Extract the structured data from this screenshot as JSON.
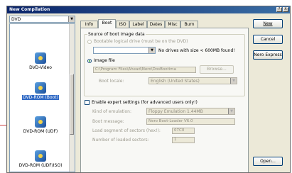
{
  "window": {
    "title": "New Compilation",
    "controls": {
      "help": "?",
      "close": "X"
    }
  },
  "media_combo": {
    "value": "DVD"
  },
  "disc_types": [
    {
      "label": "DVD-Video",
      "selected": false
    },
    {
      "label": "DVD-ROM (Boot)",
      "selected": true
    },
    {
      "label": "DVD-ROM (UDF)",
      "selected": false
    },
    {
      "label": "DVD-ROM (UDF/ISO)",
      "selected": false
    }
  ],
  "tabs": [
    "Info",
    "Boot",
    "ISO",
    "Label",
    "Dates",
    "Misc",
    "Burn"
  ],
  "active_tab": "Boot",
  "boot": {
    "source_group": "Source of boot image data",
    "bootable_drive_label": "Bootable logical drive (must be on the DVD)",
    "drive_status": "No drives with size < 600MB found!",
    "image_file_label": "Image file",
    "image_path": "C:\\Program Files\\Ahead\\Nero\\DosBootima",
    "browse_label": "Browse...",
    "boot_locale_label": "Boot locale:",
    "boot_locale_value": "English (United States)",
    "expert_label": "Enable expert settings (for advanced users only!)",
    "emulation_label": "Kind of emulation:",
    "emulation_value": "Floppy Emulation 1.44MB",
    "boot_message_label": "Boot message:",
    "boot_message_value": "Nero Boot-Loader V6.0",
    "load_segment_label": "Load segment of sectors (hex!):",
    "load_segment_value": "07C0",
    "num_sectors_label": "Number of loaded sectors:",
    "num_sectors_value": "1"
  },
  "buttons": {
    "new": "New",
    "cancel": "Cancel",
    "nero_express": "Nero Express",
    "open": "Open..."
  }
}
